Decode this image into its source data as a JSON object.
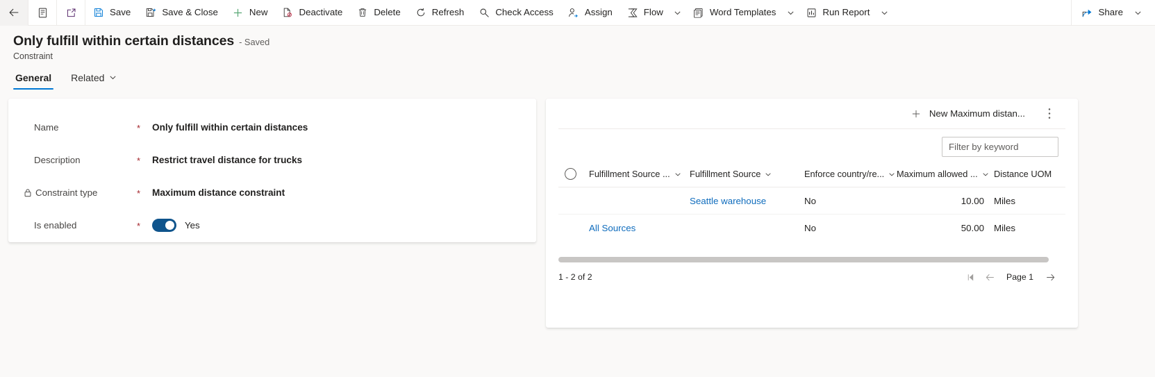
{
  "commandbar": {
    "back_icon": "back-arrow-icon",
    "form_selector_icon": "form-list-icon",
    "popout_icon": "open-in-new-window-icon",
    "items": [
      {
        "label": "Save",
        "icon": "save-icon"
      },
      {
        "label": "Save & Close",
        "icon": "save-and-close-icon"
      },
      {
        "label": "New",
        "icon": "plus-icon"
      },
      {
        "label": "Deactivate",
        "icon": "deactivate-icon"
      },
      {
        "label": "Delete",
        "icon": "trash-icon"
      },
      {
        "label": "Refresh",
        "icon": "refresh-icon"
      },
      {
        "label": "Check Access",
        "icon": "key-icon"
      },
      {
        "label": "Assign",
        "icon": "person-assign-icon"
      },
      {
        "label": "Flow",
        "icon": "flow-icon",
        "caret": true
      },
      {
        "label": "Word Templates",
        "icon": "word-template-icon",
        "caret": true
      },
      {
        "label": "Run Report",
        "icon": "report-icon",
        "caret": true
      }
    ],
    "share": {
      "label": "Share",
      "icon": "share-icon",
      "caret": true
    }
  },
  "header": {
    "title": "Only fulfill within certain distances",
    "saved_state": "- Saved",
    "entity": "Constraint"
  },
  "tabs": [
    {
      "label": "General",
      "active": true,
      "caret": false
    },
    {
      "label": "Related",
      "active": false,
      "caret": true
    }
  ],
  "form": {
    "fields": [
      {
        "label": "Name",
        "required": "*",
        "value": "Only fulfill within certain distances",
        "locked": false,
        "type": "text"
      },
      {
        "label": "Description",
        "required": "*",
        "value": "Restrict travel distance for trucks",
        "locked": false,
        "type": "text"
      },
      {
        "label": "Constraint type",
        "required": "*",
        "value": "Maximum distance constraint",
        "locked": true,
        "type": "text"
      },
      {
        "label": "Is enabled",
        "required": "*",
        "value": "Yes",
        "locked": false,
        "type": "toggle",
        "toggle_on": true
      }
    ]
  },
  "subgrid": {
    "new_button_label": "New Maximum distan...",
    "new_button_icon": "plus-icon",
    "more_commands_icon": "more-vertical-icon",
    "filter_placeholder": "Filter by keyword",
    "filter_value": "",
    "select_all_icon": "select-all-circle-icon",
    "columns": [
      {
        "label": "Fulfillment Source ...",
        "sortable": true
      },
      {
        "label": "Fulfillment Source",
        "sortable": true
      },
      {
        "label": "Enforce country/re...",
        "sortable": true
      },
      {
        "label": "Maximum allowed ...",
        "sortable": true
      },
      {
        "label": "Distance UOM",
        "sortable": false
      }
    ],
    "rows": [
      {
        "fulfillment_source_group": "",
        "fulfillment_source": "Seattle warehouse",
        "fulfillment_source_is_link": true,
        "enforce_country": "No",
        "maximum_allowed": "10.00",
        "distance_uom": "Miles"
      },
      {
        "fulfillment_source_group": "All Sources",
        "fulfillment_source": "",
        "fulfillment_source_is_link": false,
        "enforce_country": "No",
        "maximum_allowed": "50.00",
        "distance_uom": "Miles"
      }
    ],
    "footer": {
      "count_text": "1 - 2 of 2",
      "page_label": "Page 1",
      "first_page_icon": "first-page-icon",
      "prev_page_icon": "previous-page-icon",
      "next_page_icon": "next-page-icon"
    }
  },
  "colors": {
    "accent": "#0078d4",
    "link": "#0f6cbd",
    "required": "#a4262c",
    "toggle_on": "#0f548c",
    "page_bg": "#faf9f8"
  }
}
